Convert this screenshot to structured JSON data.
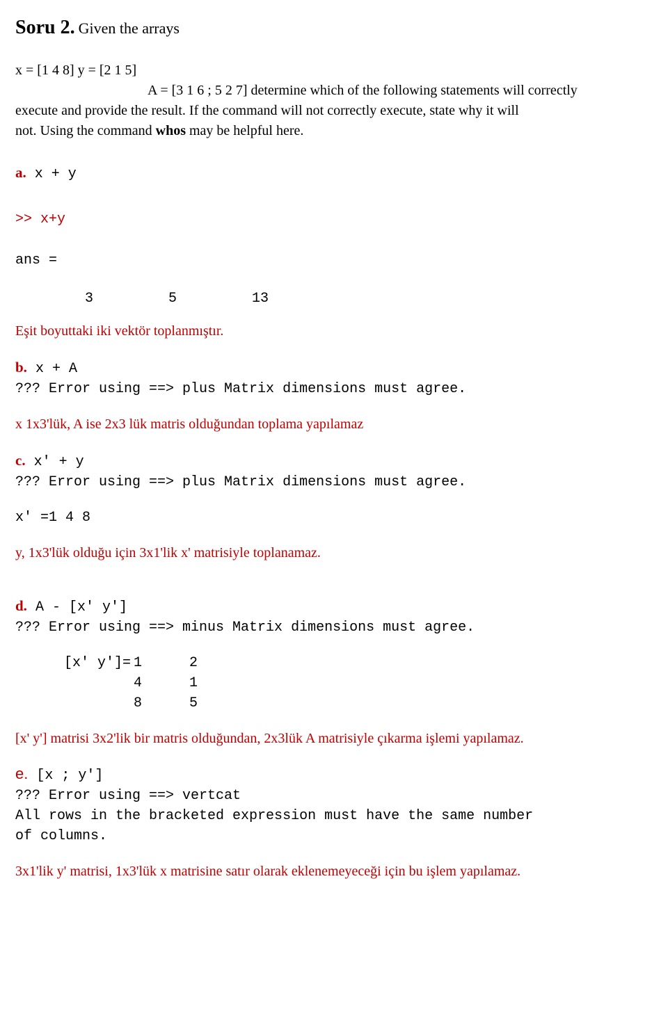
{
  "title_prefix": "Soru 2.",
  "title_rest": " Given the arrays",
  "line_xy": "x = [1 4 8] y = [2 1 5]",
  "line_A": "A = [3 1 6 ; 5 2 7] determine which of the following statements will correctly",
  "para1_l2": "execute and provide the result. If the command will not correctly execute, state why it will",
  "para1_l3": "not. Using the command ",
  "para1_whos": "whos",
  "para1_l3b": " may be helpful here.",
  "a": {
    "label": "a.",
    "code": " x + y"
  },
  "a_cmd": ">> x+y",
  "a_ans": "ans =",
  "a_vals": [
    "3",
    "5",
    "13"
  ],
  "a_expl": "Eşit boyuttaki iki vektör toplanmıştır.",
  "b": {
    "label": "b.",
    "code": " x + A"
  },
  "b_err": "??? Error using ==> plus Matrix dimensions must agree.",
  "b_expl": "x 1x3'lük, A ise 2x3 lük matris olduğundan toplama yapılamaz",
  "c": {
    "label": "c.",
    "code": " x' + y"
  },
  "c_err": "??? Error using ==> plus Matrix dimensions must agree.",
  "c_xprime": "x' =1 4 8",
  "c_expl": "y, 1x3'lük olduğu için 3x1'lik x' matrisiyle toplanamaz.",
  "d": {
    "label": "d.",
    "code": " A - [x' y']"
  },
  "d_err": "??? Error using ==> minus Matrix dimensions must agree.",
  "d_mat_label": "[x' y']=",
  "d_mat": [
    [
      "1",
      "2"
    ],
    [
      "4",
      "1"
    ],
    [
      "8",
      "5"
    ]
  ],
  "d_expl": "[x' y'] matrisi 3x2'lik bir matris olduğundan, 2x3lük A matrisiyle çıkarma işlemi yapılamaz.",
  "e": {
    "label": "e.",
    "code": " [x ; y']"
  },
  "e_err": "??? Error using ==> vertcat",
  "e_err2a": "All rows in the bracketed expression must have the same number",
  "e_err2b": "of columns.",
  "e_expl": "3x1'lik y' matrisi, 1x3'lük x matrisine satır olarak eklenemeyeceği için bu işlem yapılamaz."
}
